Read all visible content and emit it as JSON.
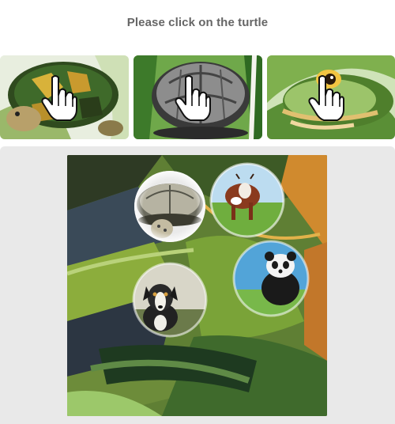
{
  "prompt": {
    "text": "Please click on the turtle"
  },
  "examples": [
    {
      "subject": "turtle"
    },
    {
      "subject": "turtle"
    },
    {
      "subject": "turtle"
    }
  ],
  "scene": {
    "animals": [
      "turtle",
      "cow",
      "panda",
      "dog"
    ]
  },
  "colors": {
    "prompt_text": "#666666",
    "stage_background": "#e9e9e9"
  },
  "icons": {
    "pointer": "hand-pointer-icon"
  }
}
